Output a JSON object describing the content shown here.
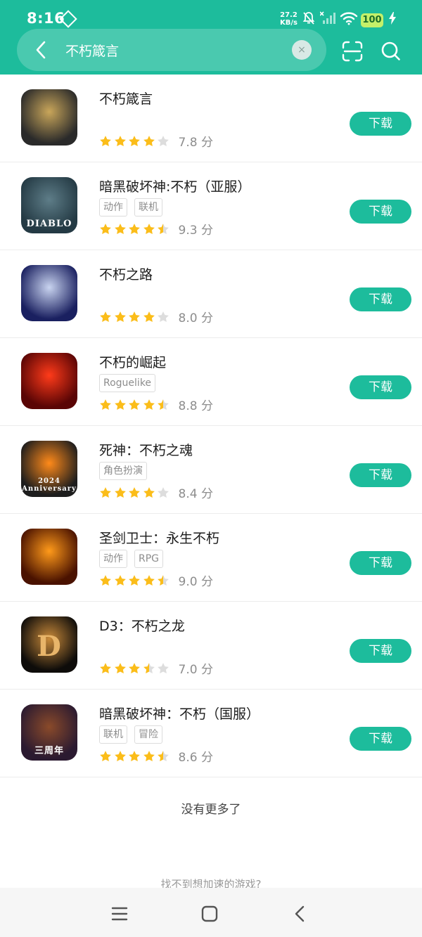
{
  "status_bar": {
    "time": "8:16",
    "net_speed_value": "27.2",
    "net_speed_unit": "KB/s",
    "battery": "100",
    "icons": [
      "app-diamond-icon",
      "mute-bell-icon",
      "no-signal-icon",
      "wifi-icon",
      "battery-icon",
      "charging-icon"
    ]
  },
  "search": {
    "value": "不朽箴言",
    "clear_label": "×"
  },
  "colors": {
    "accent": "#1dbc9c",
    "star": "#fbbd1a",
    "star_empty": "#dddddd",
    "battery": "#c4f06a"
  },
  "download_label": "下载",
  "apps": [
    {
      "name": "不朽箴言",
      "tags": [],
      "stars": 4,
      "score": "7.8 分",
      "icon": "immortal-proverbs-game-icon",
      "icon_colors": [
        "#2a2a2a",
        "#c9a65a"
      ]
    },
    {
      "name": "暗黑破坏神:不朽（亚服）",
      "tags": [
        "动作",
        "联机"
      ],
      "stars": 4.5,
      "score": "9.3 分",
      "icon": "diablo-game-icon",
      "icon_text": "DIABLO",
      "icon_colors": [
        "#243a44",
        "#5e7d88"
      ]
    },
    {
      "name": "不朽之路",
      "tags": [],
      "stars": 4,
      "score": "8.0 分",
      "icon": "immortal-road-game-icon",
      "icon_colors": [
        "#1a2060",
        "#c9d4f0"
      ]
    },
    {
      "name": "不朽的崛起",
      "tags": [
        "Roguelike"
      ],
      "stars": 4.5,
      "score": "8.8 分",
      "icon": "immortal-rise-game-icon",
      "icon_colors": [
        "#5a0505",
        "#ff3b1a"
      ]
    },
    {
      "name": "死神：不朽之魂",
      "tags": [
        "角色扮演"
      ],
      "stars": 4,
      "score": "8.4 分",
      "icon": "bleach-game-icon",
      "icon_text": "2024 Anniversary",
      "icon_colors": [
        "#1d1d1d",
        "#ff8a1a"
      ]
    },
    {
      "name": "圣剑卫士：永生不朽",
      "tags": [
        "动作",
        "RPG"
      ],
      "stars": 4.5,
      "score": "9.0 分",
      "icon": "holy-sword-guardian-game-icon",
      "icon_colors": [
        "#4a1200",
        "#ff9a1a"
      ]
    },
    {
      "name": "D3：不朽之龙",
      "tags": [],
      "stars": 3.5,
      "score": "7.0 分",
      "icon": "d3-dragon-game-icon",
      "icon_text": "D",
      "icon_colors": [
        "#0e0c0a",
        "#c98a3a"
      ]
    },
    {
      "name": "暗黑破坏神：不朽（国服）",
      "tags": [
        "联机",
        "冒险"
      ],
      "stars": 4.5,
      "score": "8.6 分",
      "icon": "diablo-cn-game-icon",
      "icon_text": "三周年",
      "icon_colors": [
        "#2b1a30",
        "#8a4a2a"
      ]
    }
  ],
  "footer": {
    "no_more": "没有更多了",
    "cant_find": "找不到想加速的游戏?"
  }
}
